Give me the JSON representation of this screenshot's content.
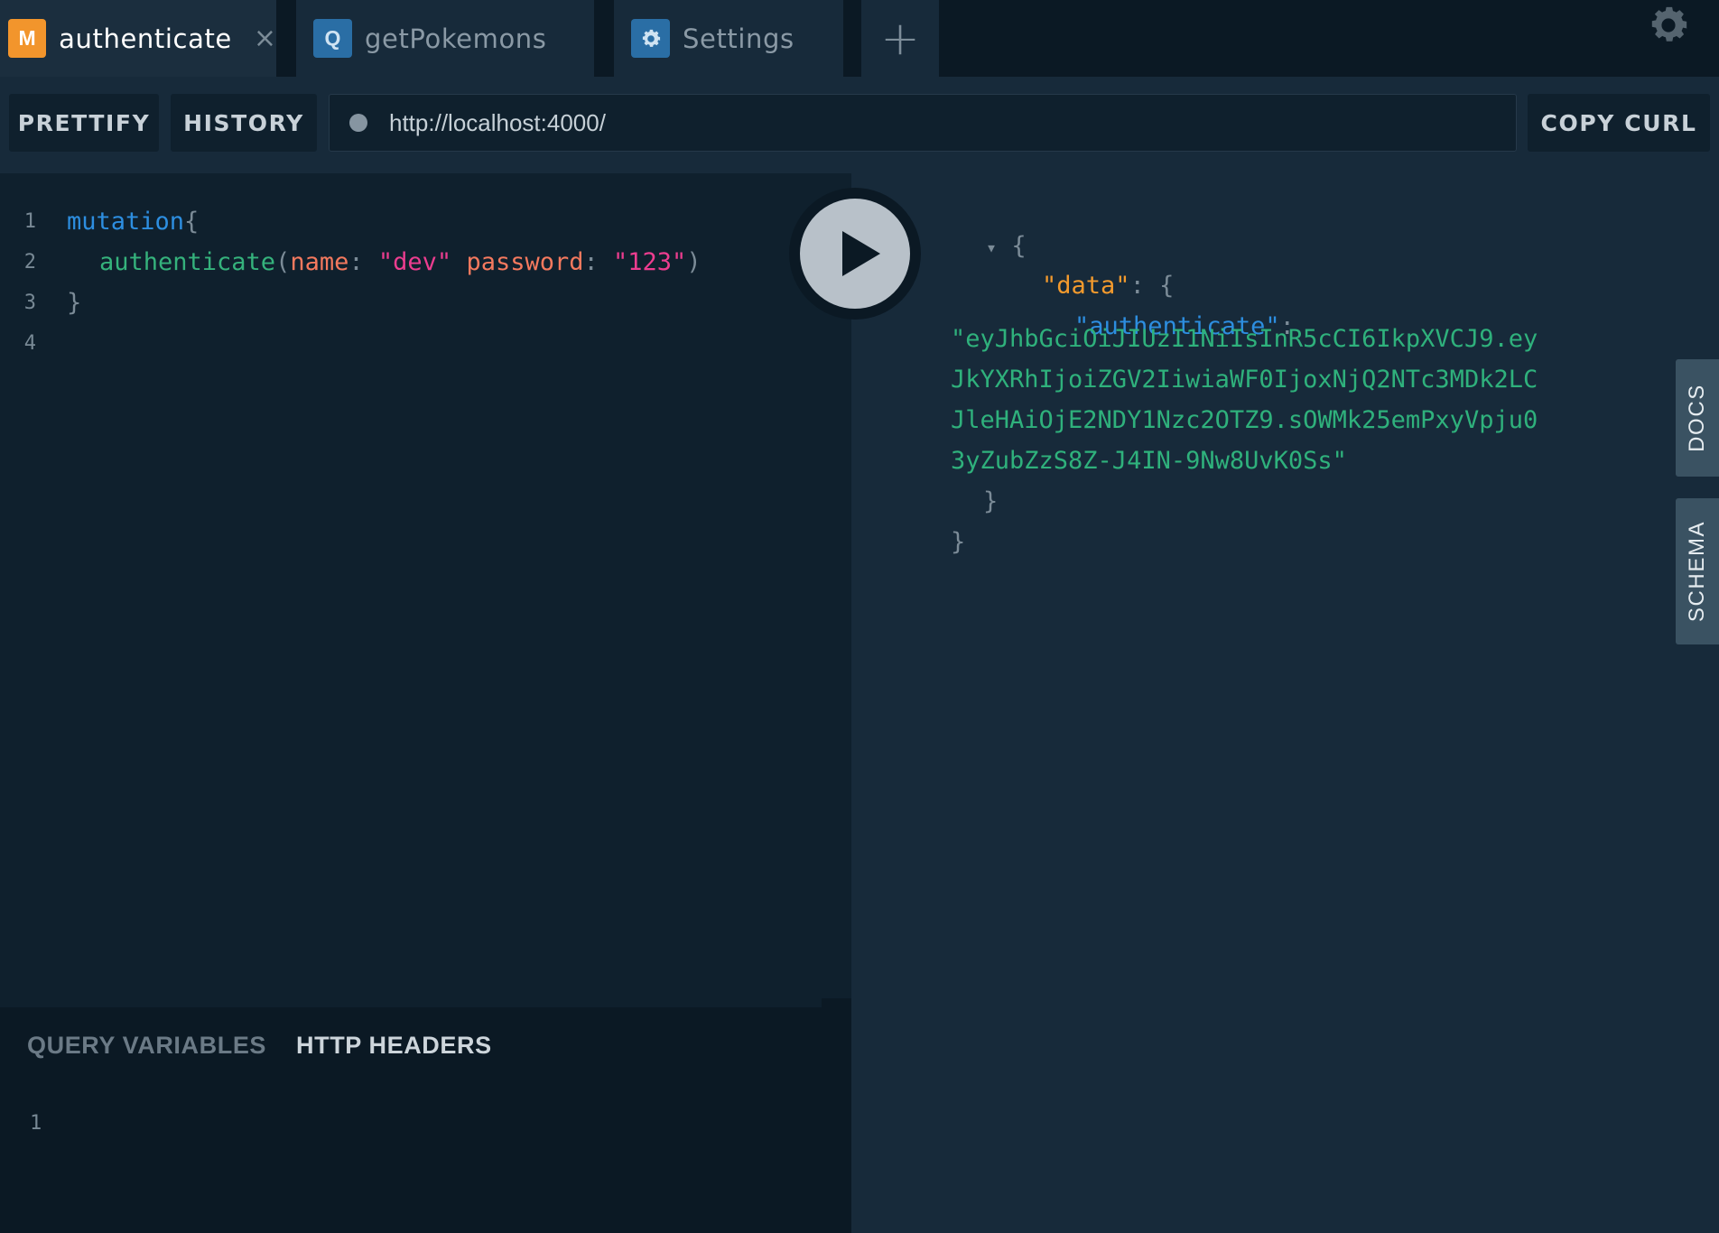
{
  "tabs": [
    {
      "badge": "M",
      "label": "authenticate",
      "close": "×",
      "active": true
    },
    {
      "badge": "Q",
      "label": "getPokemons",
      "active": false
    },
    {
      "badge": "gear-icon",
      "label": "Settings",
      "active": false
    }
  ],
  "tab_add": "+",
  "toolbar": {
    "prettify_label": "PRETTIFY",
    "history_label": "HISTORY",
    "endpoint": "http://localhost:4000/",
    "copy_curl_label": "COPY CURL"
  },
  "editor": {
    "line_numbers": [
      "1",
      "2",
      "3",
      "4"
    ],
    "line1": {
      "keyword": "mutation",
      "brace": "{"
    },
    "line2": {
      "fn": "authenticate",
      "open": "(",
      "arg1": "name",
      "colon1": ":",
      "val1": "\"dev\"",
      "arg2": "password",
      "colon2": ":",
      "val2": "\"123\"",
      "close": ")"
    },
    "line3": {
      "brace": "}"
    }
  },
  "variables_panel": {
    "query_variables_label": "QUERY VARIABLES",
    "http_headers_label": "HTTP HEADERS",
    "line_number": "1"
  },
  "result": {
    "collapse_arrow": "▾",
    "open_brace": "{",
    "data_key": "\"data\"",
    "data_colon": ": {",
    "auth_key": "\"authenticate\"",
    "auth_colon": ":",
    "token_lines": [
      "\"eyJhbGciOiJIUzI1NiIsInR5cCI6IkpXVCJ9.ey",
      "JkYXRhIjoiZGV2IiwiaWF0IjoxNjQ2NTc3MDk2LC",
      "JleHAiOjE2NDY1Nzc2OTZ9.sOWMk25emPxyVpju0",
      "3yZubZzS8Z-J4IN-9Nw8UvK0Ss\""
    ],
    "inner_close": "}",
    "outer_close": "}"
  },
  "side_tabs": {
    "docs": "DOCS",
    "schema": "SCHEMA"
  },
  "colors": {
    "mutation_badge": "#f2952c",
    "query_badge": "#2a6ea5",
    "background": "#0f202d",
    "panel": "#172a3a"
  }
}
